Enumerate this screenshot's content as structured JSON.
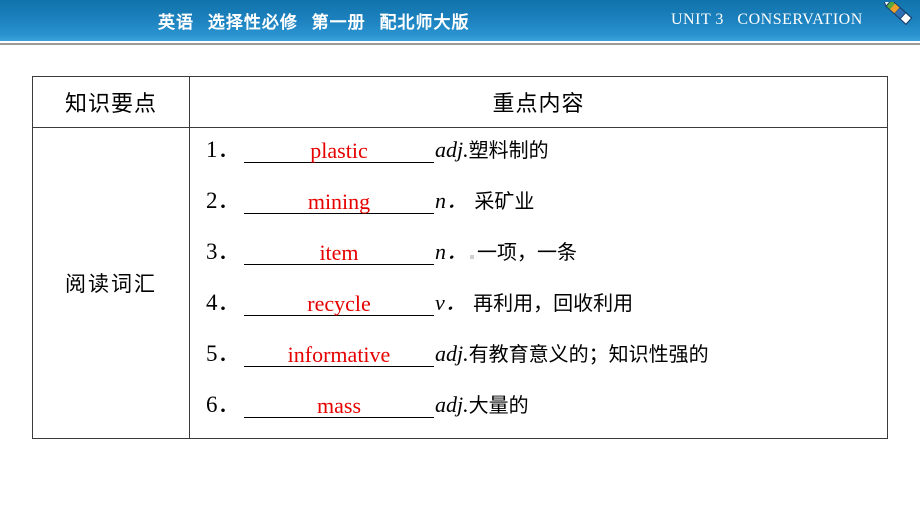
{
  "header": {
    "course_title": "英语  选择性必修  第一册  配北师大版",
    "unit_label": "UNIT 3   CONSERVATION",
    "icon": "pencil-icon",
    "bg_color_top": "#1173ab",
    "bg_color_bottom": "#3ba2da",
    "text_color": "#ffffff"
  },
  "table": {
    "columns": [
      {
        "header": "知识要点"
      },
      {
        "header": "重点内容"
      }
    ],
    "category": "阅读词汇",
    "accent_answer_color": "#e60000",
    "rows": [
      {
        "num": "1．",
        "answer": "plastic",
        "pos": "adj.",
        "meaning": "塑料制的",
        "pos_space": false,
        "artifact": false
      },
      {
        "num": "2．",
        "answer": "mining",
        "pos": "n．",
        "meaning": " 采矿业",
        "pos_space": true,
        "artifact": false
      },
      {
        "num": "3．",
        "answer": "item",
        "pos": "n．",
        "meaning": "一项，一条",
        "pos_space": true,
        "artifact": true
      },
      {
        "num": "4．",
        "answer": "recycle",
        "pos": "v．",
        "meaning": " 再利用，回收利用",
        "pos_space": true,
        "artifact": false
      },
      {
        "num": "5．",
        "answer": "informative",
        "pos": "adj.",
        "meaning": "有教育意义的；知识性强的",
        "pos_space": false,
        "artifact": false
      },
      {
        "num": "6．",
        "answer": "mass",
        "pos": "adj.",
        "meaning": "大量的",
        "pos_space": false,
        "artifact": false
      }
    ]
  }
}
